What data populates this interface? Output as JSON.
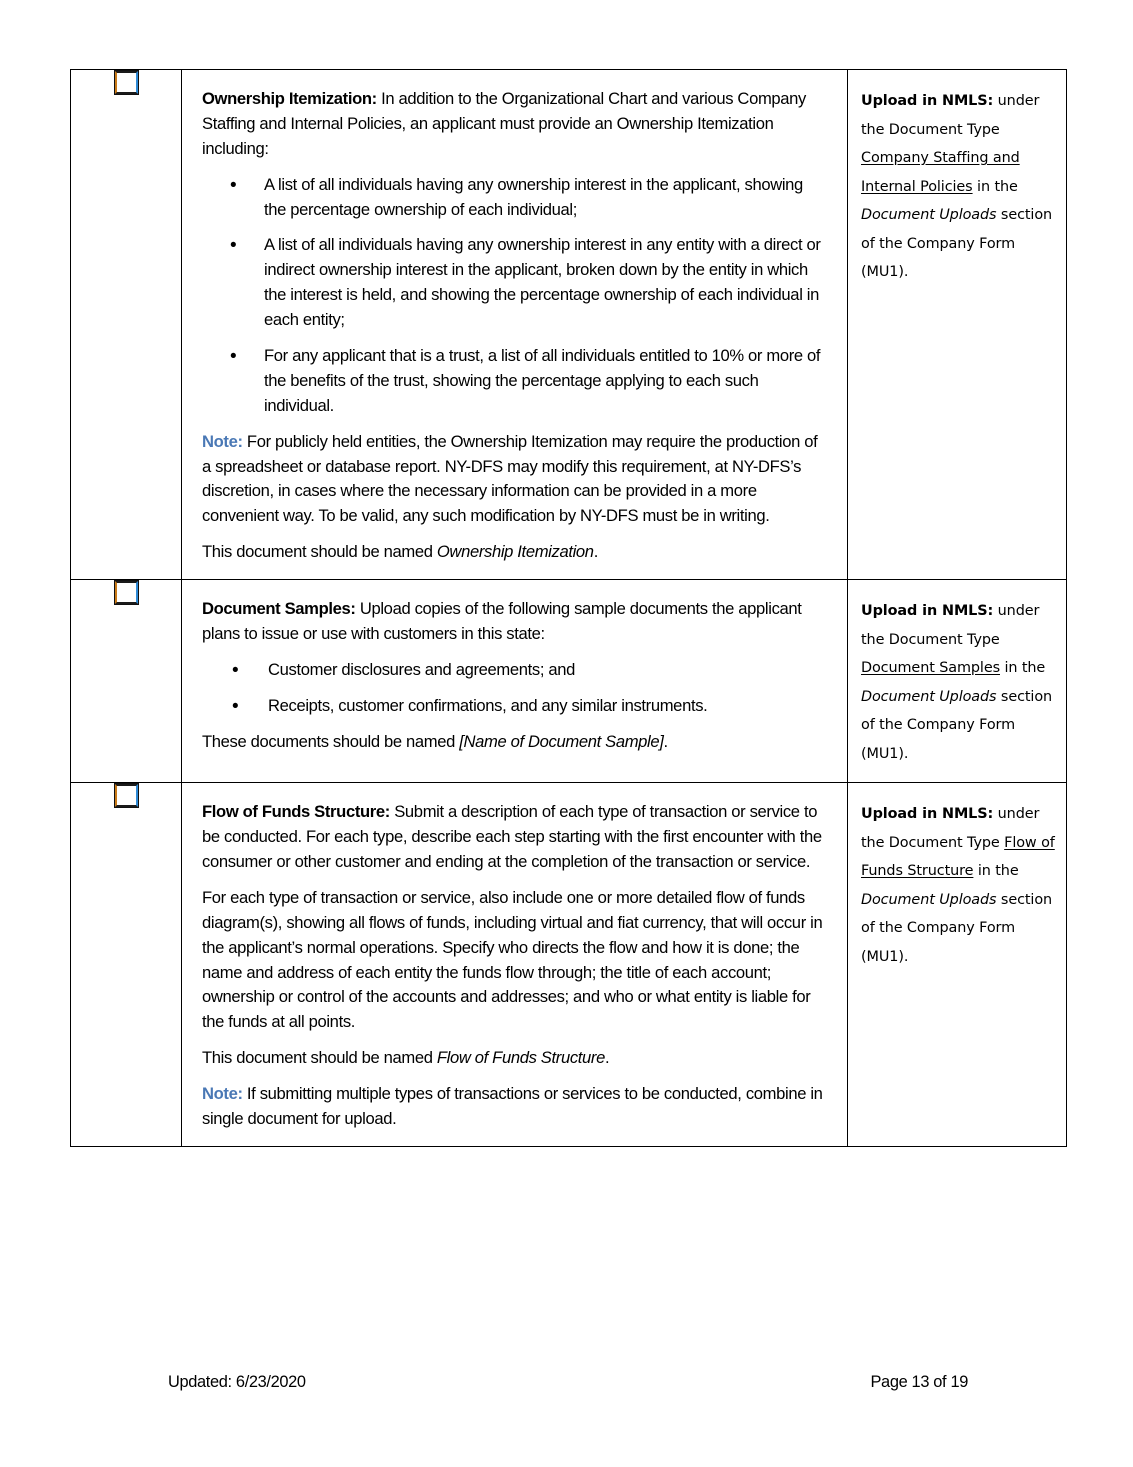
{
  "document": {
    "type": "checklist-table",
    "rows": [
      {
        "checkbox_name": "ownership-itemization-checkbox",
        "checked": false,
        "description": {
          "title": "Ownership Itemization:",
          "intro": " In addition to the Organizational Chart and various Company Staffing and Internal Policies, an applicant must provide an Ownership Itemization including:",
          "bullets": [
            "A list of all individuals having any ownership interest in the applicant, showing the percentage ownership of each individual;",
            "A list of all individuals having any ownership interest in any entity with a direct or indirect ownership interest in the applicant, broken down by the entity in which the interest is held, and showing the percentage ownership of each individual in each entity;",
            "For any applicant that is a trust, a list of all individuals entitled to 10% or more of the benefits of the trust, showing the percentage applying to each such individual."
          ],
          "note_label": "Note:",
          "note_text": " For publicly held entities, the Ownership Itemization may require the production of a spreadsheet or database report.  NY-DFS may modify this requirement, at NY-DFS’s discretion, in cases where the necessary information can be provided in a more convenient way.  To be valid, any such modification by NY-DFS must be in writing.",
          "naming_prefix": "This document should be named ",
          "naming_italic": "Ownership Itemization",
          "naming_suffix": "."
        },
        "nmls": {
          "label": "Upload in NMLS:",
          "text_1": " under the Document Type ",
          "doc_type": "Company Staffing and Internal Policies",
          "text_2": " in the ",
          "section_italic": "Document Uploads",
          "text_3": " section of the Company Form (MU1)."
        }
      },
      {
        "checkbox_name": "document-samples-checkbox",
        "checked": false,
        "description": {
          "title": "Document Samples:",
          "intro": " Upload copies of the following sample documents the applicant plans to issue or use with customers in this state:",
          "bullets": [
            "Customer disclosures and agreements; and",
            "Receipts, customer confirmations, and any similar instruments."
          ],
          "naming_prefix": "These documents should be named ",
          "naming_italic": "[Name of Document Sample]",
          "naming_suffix": "."
        },
        "nmls": {
          "label": "Upload in NMLS:",
          "text_1": " under the Document Type ",
          "doc_type": "Document Samples",
          "text_2": " in the ",
          "section_italic": "Document Uploads",
          "text_3": " section of the Company Form (MU1)."
        }
      },
      {
        "checkbox_name": "flow-of-funds-structure-checkbox",
        "checked": false,
        "description": {
          "title": "Flow of Funds Structure:",
          "intro": " Submit a description of each type of transaction or service to be conducted.  For each type, describe each step starting with the first encounter with the consumer or other customer and ending at the completion of the transaction or service.",
          "paragraph_2": "For each type of transaction or service, also include one or more detailed flow of funds diagram(s), showing all flows of funds, including virtual and fiat currency, that will occur in the applicant’s normal operations.  Specify who directs the flow and how it is done; the name and address of each entity the funds flow through; the title of each account; ownership or control of the accounts and addresses; and who or what entity is liable for the funds at all points.",
          "naming_prefix": "This document should be named ",
          "naming_italic": "Flow of Funds Structure",
          "naming_suffix": ".",
          "note_label": "Note:",
          "note_text": " If submitting multiple types of transactions or services to be conducted, combine in single document for upload."
        },
        "nmls": {
          "label": "Upload in NMLS:",
          "text_1": " under the Document Type ",
          "doc_type": "Flow of Funds Structure",
          "text_2": " in the ",
          "section_italic": "Document Uploads",
          "text_3": " section of the Company Form (MU1)."
        }
      }
    ]
  },
  "footer": {
    "updated": "Updated: 6/23/2020",
    "page": "Page 13 of 19"
  },
  "colors": {
    "note_accent": "#4a78b5",
    "border": "#000000",
    "text": "#000000",
    "checkbox_left": "#c87a18",
    "checkbox_right": "#2e8ad6"
  }
}
